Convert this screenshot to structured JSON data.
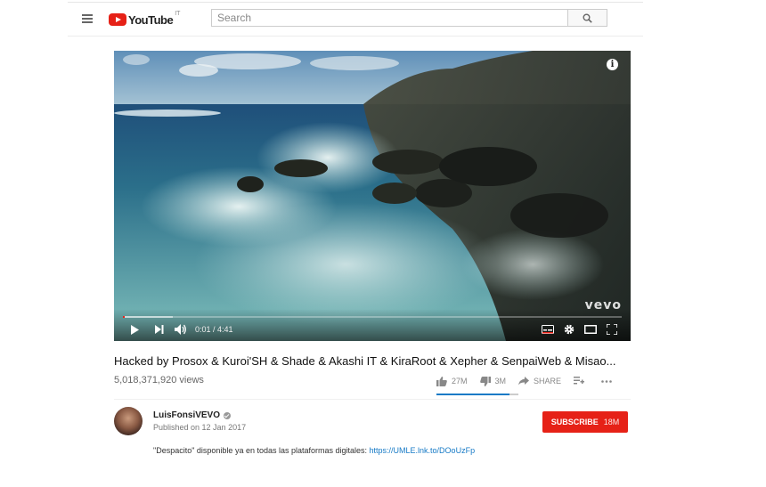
{
  "masthead": {
    "logo_text": "YouTube",
    "logo_region": "IT",
    "search_placeholder": "Search"
  },
  "player": {
    "watermark": "vevo",
    "info_glyph": "i",
    "current_time": "0:01",
    "duration": "4:41",
    "time_display": "0:01 / 4:41",
    "progress_fraction": 0.004,
    "buffered_fraction": 0.1
  },
  "video": {
    "title": "Hacked by Prosox & Kuroi'SH & Shade & Akashi IT & KiraRoot & Xepher & SenpaiWeb & Misao...",
    "views": "5,018,371,920 views",
    "likes": "27M",
    "dislikes": "3M",
    "share_label": "SHARE",
    "like_ratio": 0.89
  },
  "channel": {
    "name": "LuisFonsiVEVO",
    "published": "Published on 12 Jan 2017",
    "subscribe_label": "SUBSCRIBE",
    "subscriber_count": "18M"
  },
  "description": {
    "text": "\"Despacito\" disponible ya en todas las plataformas digitales: ",
    "link": "https://UMLE.lnk.to/DOoUzFp"
  },
  "colors": {
    "brand_red": "#e62117",
    "link_blue": "#167ac6"
  },
  "icons": [
    "menu-icon",
    "youtube-logo-icon",
    "search-icon",
    "info-icon",
    "play-icon",
    "next-icon",
    "volume-icon",
    "subtitles-icon",
    "settings-icon",
    "theater-icon",
    "fullscreen-icon",
    "thumbs-up-icon",
    "thumbs-down-icon",
    "share-icon",
    "add-to-playlist-icon",
    "more-icon",
    "verified-icon"
  ]
}
